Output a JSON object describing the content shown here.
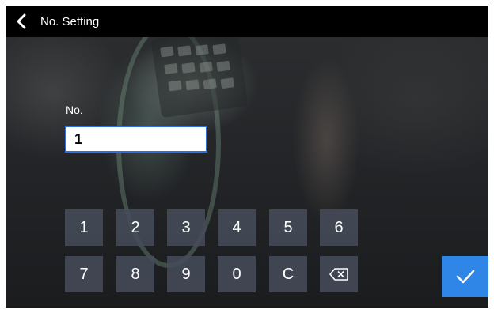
{
  "header": {
    "title": "No. Setting",
    "back_icon": "chevron-left-icon"
  },
  "form": {
    "label": "No.",
    "value": "1"
  },
  "keypad": {
    "row1": [
      "1",
      "2",
      "3",
      "4",
      "5",
      "6"
    ],
    "row2": [
      "7",
      "8",
      "9",
      "0",
      "C"
    ],
    "backspace_icon": "backspace-icon",
    "confirm_icon": "checkmark-icon"
  },
  "colors": {
    "header_bg": "#000000",
    "input_border": "#2f6fe0",
    "key_bg": "#464c5a",
    "confirm_bg": "#2f86e6"
  }
}
